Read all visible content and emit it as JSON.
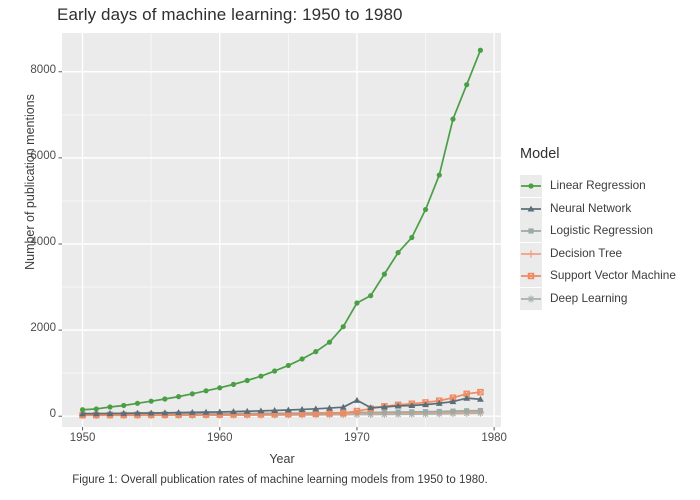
{
  "figure": {
    "title": "Early days of machine learning: 1950 to 1980",
    "caption": "Figure 1: Overall publication rates of machine learning models from 1950 to 1980."
  },
  "legend": {
    "title": "Model",
    "position": "right"
  },
  "panel": {
    "background": "#ebebeb",
    "major_grid_color": "#ffffff",
    "minor_grid_color": "#f7f7f7"
  },
  "chart_data": {
    "type": "line",
    "title": "Early days of machine learning: 1950 to 1980",
    "xlabel": "Year",
    "ylabel": "Number of publication mentions",
    "xlim": [
      1948.5,
      1980.5
    ],
    "ylim": [
      -250,
      8900
    ],
    "xticks": [
      1950,
      1960,
      1970,
      1980
    ],
    "yticks": [
      0,
      2000,
      4000,
      6000,
      8000
    ],
    "grid": true,
    "legend_title": "Model",
    "legend_position": "right",
    "x": [
      1950,
      1951,
      1952,
      1953,
      1954,
      1955,
      1956,
      1957,
      1958,
      1959,
      1960,
      1961,
      1962,
      1963,
      1964,
      1965,
      1966,
      1967,
      1968,
      1969,
      1970,
      1971,
      1972,
      1973,
      1974,
      1975,
      1976,
      1977,
      1978,
      1979
    ],
    "series": [
      {
        "name": "Linear Regression",
        "color": "#4a9e45",
        "marker": "circle",
        "values": [
          150,
          170,
          215,
          250,
          300,
          350,
          400,
          455,
          520,
          590,
          660,
          740,
          830,
          930,
          1050,
          1180,
          1330,
          1500,
          1720,
          2080,
          2630,
          2800,
          3300,
          3800,
          4150,
          4800,
          5600,
          6900,
          7700,
          8500
        ]
      },
      {
        "name": "Neural Network",
        "color": "#5a6e78",
        "marker": "triangle",
        "values": [
          60,
          62,
          65,
          68,
          72,
          75,
          80,
          85,
          90,
          95,
          100,
          108,
          115,
          125,
          135,
          145,
          158,
          172,
          190,
          210,
          370,
          200,
          215,
          240,
          250,
          270,
          300,
          340,
          420,
          395
        ]
      },
      {
        "name": "Logistic Regression",
        "color": "#9aaaa5",
        "marker": "square",
        "values": [
          45,
          46,
          47,
          48,
          50,
          51,
          53,
          54,
          56,
          58,
          60,
          62,
          64,
          66,
          68,
          70,
          73,
          75,
          78,
          82,
          90,
          88,
          92,
          96,
          100,
          105,
          110,
          118,
          126,
          132
        ]
      },
      {
        "name": "Decision Tree",
        "color": "#f2a183",
        "marker": "plus",
        "values": [
          30,
          31,
          32,
          33,
          34,
          35,
          36,
          37,
          39,
          40,
          41,
          43,
          44,
          46,
          48,
          50,
          52,
          54,
          56,
          58,
          62,
          63,
          66,
          70,
          74,
          78,
          84,
          90,
          96,
          102
        ]
      },
      {
        "name": "Support Vector Machine",
        "color": "#ef8a62",
        "marker": "square-cross",
        "values": [
          25,
          26,
          27,
          28,
          29,
          30,
          32,
          33,
          35,
          36,
          38,
          40,
          42,
          44,
          47,
          50,
          54,
          58,
          64,
          72,
          120,
          175,
          230,
          265,
          290,
          320,
          360,
          430,
          520,
          560
        ]
      },
      {
        "name": "Deep Learning",
        "color": "#a5b2ad",
        "marker": "asterisk",
        "values": [
          18,
          18,
          19,
          19,
          20,
          20,
          21,
          22,
          22,
          23,
          24,
          25,
          26,
          27,
          28,
          29,
          31,
          32,
          34,
          36,
          40,
          41,
          43,
          45,
          48,
          51,
          55,
          60,
          66,
          72
        ]
      }
    ]
  },
  "axis": {
    "x_title": "Year",
    "y_title": "Number of publication mentions",
    "x_ticklabels": [
      "1950",
      "1960",
      "1970",
      "1980"
    ],
    "y_ticklabels": [
      "0",
      "2000",
      "4000",
      "6000",
      "8000"
    ]
  }
}
